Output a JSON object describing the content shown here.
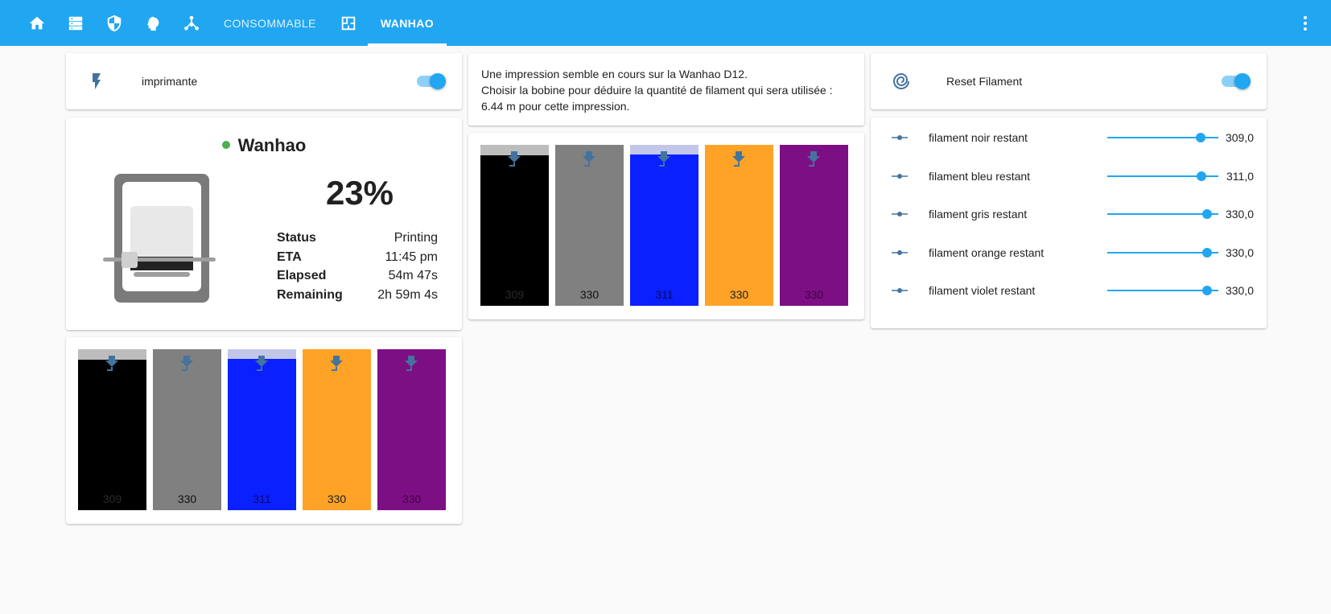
{
  "header": {
    "tabs": [
      {
        "icon": "home-icon"
      },
      {
        "icon": "server-icon"
      },
      {
        "icon": "shield-icon"
      },
      {
        "icon": "brain-icon"
      },
      {
        "icon": "network-icon"
      },
      {
        "label": "CONSOMMABLE"
      },
      {
        "icon": "floorplan-icon"
      },
      {
        "label": "WANHAO",
        "active": true
      }
    ],
    "menu_icon": "dots-vertical-icon"
  },
  "printer_switch": {
    "label": "imprimante",
    "icon": "flash-icon",
    "on": true
  },
  "message": {
    "line1": "Une impression semble en cours sur la Wanhao D12.",
    "line2": "Choisir la bobine pour déduire la quantité de filament qui sera utilisée :",
    "line3": "6.44 m pour cette impression."
  },
  "reset": {
    "label": "Reset Filament",
    "icon": "spiral-icon",
    "on": true
  },
  "printer": {
    "name": "Wanhao",
    "status_color": "#4caf50",
    "progress": "23%",
    "progress_fraction": 0.23,
    "stats": [
      {
        "key": "Status",
        "value": "Printing"
      },
      {
        "key": "ETA",
        "value": "11:45 pm"
      },
      {
        "key": "Elapsed",
        "value": "54m 47s"
      },
      {
        "key": "Remaining",
        "value": "2h 59m 4s"
      }
    ]
  },
  "spools": [
    {
      "label": "309",
      "color": "#000000",
      "empty_color": "#bdbdbd",
      "fill_fraction": 0.936,
      "text_color": "#2a2a2a"
    },
    {
      "label": "330",
      "color": "#808080",
      "empty_color": "#bdbdbd",
      "fill_fraction": 1.0,
      "text_color": "#111111"
    },
    {
      "label": "311",
      "color": "#0a20ff",
      "empty_color": "#c2c6e8",
      "fill_fraction": 0.942,
      "text_color": "#0a0a66"
    },
    {
      "label": "330",
      "color": "#ffa327",
      "empty_color": "#f5d9aa",
      "fill_fraction": 1.0,
      "text_color": "#222222"
    },
    {
      "label": "330",
      "color": "#7d0f84",
      "empty_color": "#caa2cc",
      "fill_fraction": 1.0,
      "text_color": "#3a0740"
    }
  ],
  "sliders": [
    {
      "label": "filament noir restant",
      "value": "309,0",
      "fraction": 0.936
    },
    {
      "label": "filament bleu restant",
      "value": "311,0",
      "fraction": 0.942
    },
    {
      "label": "filament gris restant",
      "value": "330,0",
      "fraction": 1.0
    },
    {
      "label": "filament orange restant",
      "value": "330,0",
      "fraction": 1.0
    },
    {
      "label": "filament violet restant",
      "value": "330,0",
      "fraction": 1.0
    }
  ],
  "colors": {
    "accent": "#21a6f2",
    "icon": "#44739e"
  }
}
